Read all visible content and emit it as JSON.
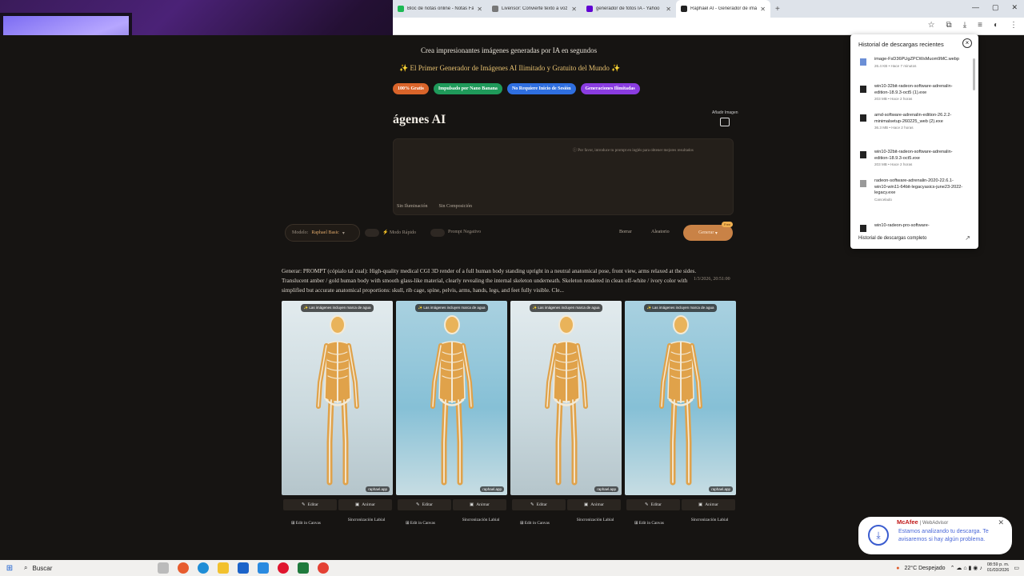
{
  "browser": {
    "tabs": [
      {
        "title": "Bloc de notas online - Notas Fá",
        "color": "#1db954"
      },
      {
        "title": "Livensor: Convierte texto a voz",
        "color": "#777777"
      },
      {
        "title": "generador de fotos IA - Yahoo",
        "color": "#6001d2"
      },
      {
        "title": "Raphael AI - Generador de imá",
        "color": "#222222",
        "active": true
      }
    ],
    "new_tab": "+",
    "close_glyph": "✕"
  },
  "hero": {
    "subtitle": "Crea impresionantes imágenes generadas por IA en segundos",
    "tagline": "✨ El Primer Generador de Imágenes AI Ilimitado y Gratuito del Mundo ✨",
    "badges": [
      {
        "label": "100% Gratis",
        "color": "#d9642a"
      },
      {
        "label": "Impulsado por Nano Banana",
        "color": "#1f9a5a"
      },
      {
        "label": "No Requiere Inicio de Sesión",
        "color": "#2f6fe0"
      },
      {
        "label": "Generaciones Ilimitadas",
        "color": "#8a3ce0"
      }
    ],
    "heading": "ágenes AI"
  },
  "prompt": {
    "add_image": "Añadir Imagen",
    "hint": "ⓘ Por favor, introduce tu prompt en inglés para obtener mejores resultados",
    "chips": [
      "Sin Iluminación",
      "Sin Composición"
    ]
  },
  "controls": {
    "model_label": "Modelo:",
    "model_value": "Raphael Basic",
    "fast_mode": "⚡ Modo Rápido",
    "negative": "Prompt Negativo",
    "clear": "Borrar",
    "random": "Aleatorio",
    "generate": "Generar",
    "free_badge": "Free"
  },
  "generation": {
    "text": "Generar: PROMPT (cópialo tal cual): High-quality medical CGI 3D render of a full human body standing upright in a neutral anatomical pose, front view, arms relaxed at the sides. Translucent amber / gold human body with smooth glass-like material, clearly revealing the internal skeleton underneath. Skeleton rendered in clean off-white / ivory color with simplified but accurate anatomical proportions: skull, rib cage, spine, pelvis, arms, hands, legs, and feet fully visible. Cle...",
    "timestamp": "1/3/2026, 20:51:00",
    "watermark": "✨ Las imágenes incluyen marca de agua",
    "site_tag": "raphael.app",
    "cards": [
      {
        "bg": "light"
      },
      {
        "bg": "blue"
      },
      {
        "bg": "light"
      },
      {
        "bg": "blue"
      }
    ],
    "actions": {
      "edit": "Editar",
      "animate": "Animar",
      "canvas": "Edit in Canvas",
      "lipsync": "Sincronización Labial"
    }
  },
  "downloads": {
    "title": "Historial de descargas recientes",
    "items": [
      {
        "name": "image-FsD36PUgZPCWsMuom9MC.webp",
        "meta": "26.4 KB • Hace 7 minutos",
        "icon": "image-file-icon"
      },
      {
        "name": "win10-32bit-radeon-software-adrenalin-edition-18.9.3-oct5 (1).exe",
        "meta": "203 MB • Hace 2 horas",
        "icon": "exe-file-icon"
      },
      {
        "name": "amd-software-adrenalin-edition-26.2.2-minimalsetup-260225_web (2).exe",
        "meta": "36.3 MB • Hace 2 horas",
        "icon": "exe-file-icon"
      },
      {
        "name": "win10-32bit-radeon-software-adrenalin-edition-18.9.3-oct5.exe",
        "meta": "203 MB • Hace 2 horas",
        "icon": "exe-file-icon"
      },
      {
        "name": "radeon-software-adrenalin-2020-22.6.1-win10-win11-64bit-legacyasics-june23-2022-legacy.exe",
        "meta": "Cancelado",
        "icon": "cancelled-icon"
      },
      {
        "name": "win10-radeon-pro-software-",
        "meta": "",
        "icon": "exe-file-icon"
      }
    ],
    "footer": "Historial de descargas completo"
  },
  "mcafee": {
    "brand": "McAfee",
    "product": "| WebAdvisor",
    "message": "Estamos analizando tu descarga. Te avisaremos si hay algún problema."
  },
  "taskbar": {
    "search": "Buscar",
    "weather": "22°C  Despejado",
    "time": "08:59 p. m.",
    "date": "01/03/2026"
  }
}
